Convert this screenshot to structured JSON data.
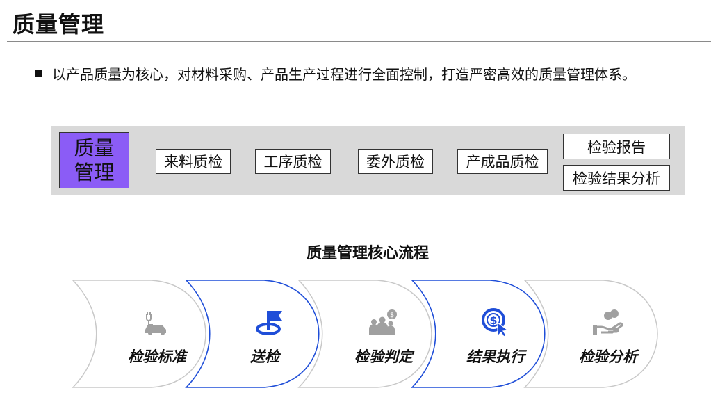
{
  "page": {
    "title": "质量管理",
    "bullet": "以产品质量为核心，对材料采购、产品生产过程进行全面控制，打造严密高效的质量管理体系。"
  },
  "overview": {
    "core": {
      "line1": "质量",
      "line2": "管理"
    },
    "items": [
      "来料质检",
      "工序质检",
      "委外质检",
      "产成品质检"
    ],
    "stacked": [
      "检验报告",
      "检验结果分析"
    ]
  },
  "flow": {
    "title": "质量管理核心流程",
    "steps": [
      {
        "label": "检验标准",
        "icon": "electric-car-icon",
        "highlight": false
      },
      {
        "label": "送检",
        "icon": "flag-pin-icon",
        "highlight": true
      },
      {
        "label": "检验判定",
        "icon": "people-money-icon",
        "highlight": false
      },
      {
        "label": "结果执行",
        "icon": "dollar-click-icon",
        "highlight": true
      },
      {
        "label": "检验分析",
        "icon": "hand-coins-icon",
        "highlight": false
      }
    ]
  },
  "colors": {
    "accent_purple": "#8b5cf6",
    "accent_blue": "#1f4ed8",
    "grey_band": "#d9d9d9",
    "icon_grey": "#a0a0a0"
  }
}
